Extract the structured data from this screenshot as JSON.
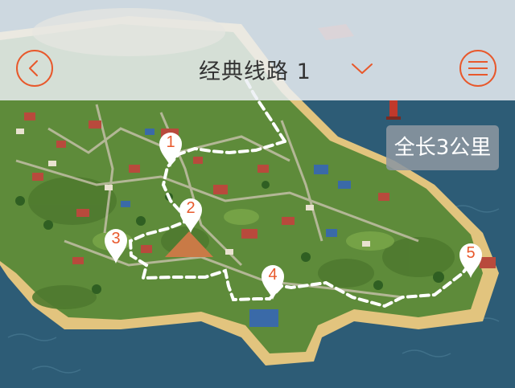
{
  "header": {
    "title": "经典线路  1",
    "back_icon": "chevron-left-icon",
    "menu_icon": "hamburger-menu-icon",
    "dropdown_icon": "chevron-down-icon"
  },
  "route": {
    "length_label": "全长3公里",
    "stops": [
      {
        "label": "1"
      },
      {
        "label": "2"
      },
      {
        "label": "3"
      },
      {
        "label": "4"
      },
      {
        "label": "5"
      }
    ]
  },
  "colors": {
    "accent": "#e8582b",
    "sea": "#2c5a73",
    "land": "#5f8a3a",
    "beach": "#e0c27a",
    "route_line": "#ffffff"
  }
}
